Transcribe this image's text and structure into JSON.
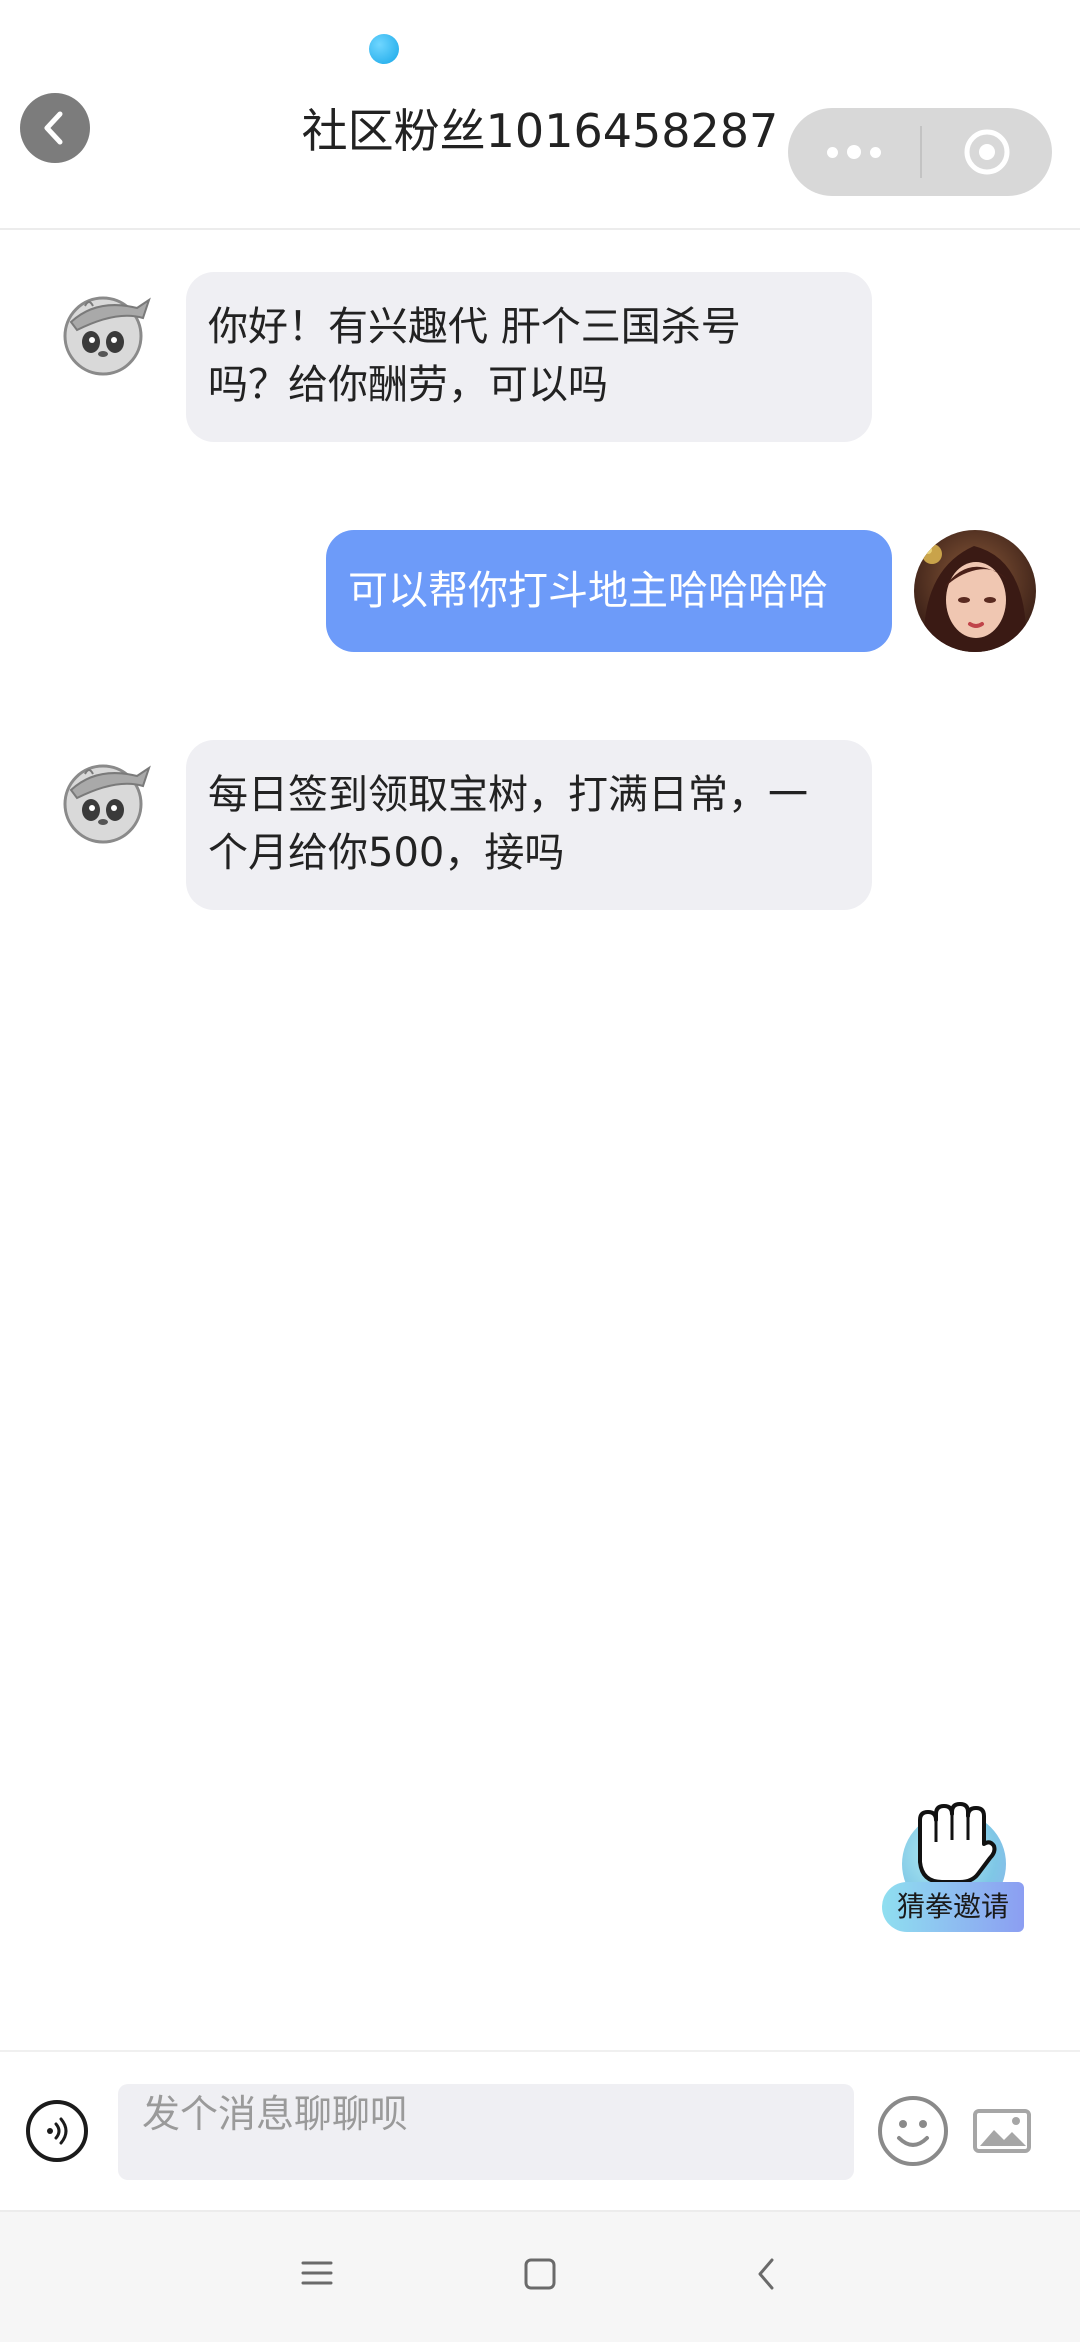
{
  "header": {
    "title": "社区粉丝1016458287"
  },
  "messages": [
    {
      "side": "in",
      "text_line1": "你好！有兴趣代 肝个三国杀号",
      "text_line2": "吗？给你酬劳，可以吗"
    },
    {
      "side": "out",
      "text": "可以帮你打斗地主哈哈哈哈"
    },
    {
      "side": "in",
      "text_line1": "每日签到领取宝树，打满日常，一",
      "text_line2": "个月给你500，接吗"
    }
  ],
  "invite": {
    "label": "猜拳邀请"
  },
  "input": {
    "placeholder": "发个消息聊聊呗"
  },
  "colors": {
    "outgoing_bubble": "#6d9bf9",
    "incoming_bubble": "#efeff3",
    "capsule": "#d8d8d8"
  },
  "icons": [
    "back-icon",
    "more-icon",
    "close-circle-icon",
    "panda-avatar",
    "user-avatar",
    "fist-icon",
    "voice-icon",
    "emoji-icon",
    "image-icon",
    "menu-icon",
    "home-icon",
    "back-nav-icon"
  ]
}
